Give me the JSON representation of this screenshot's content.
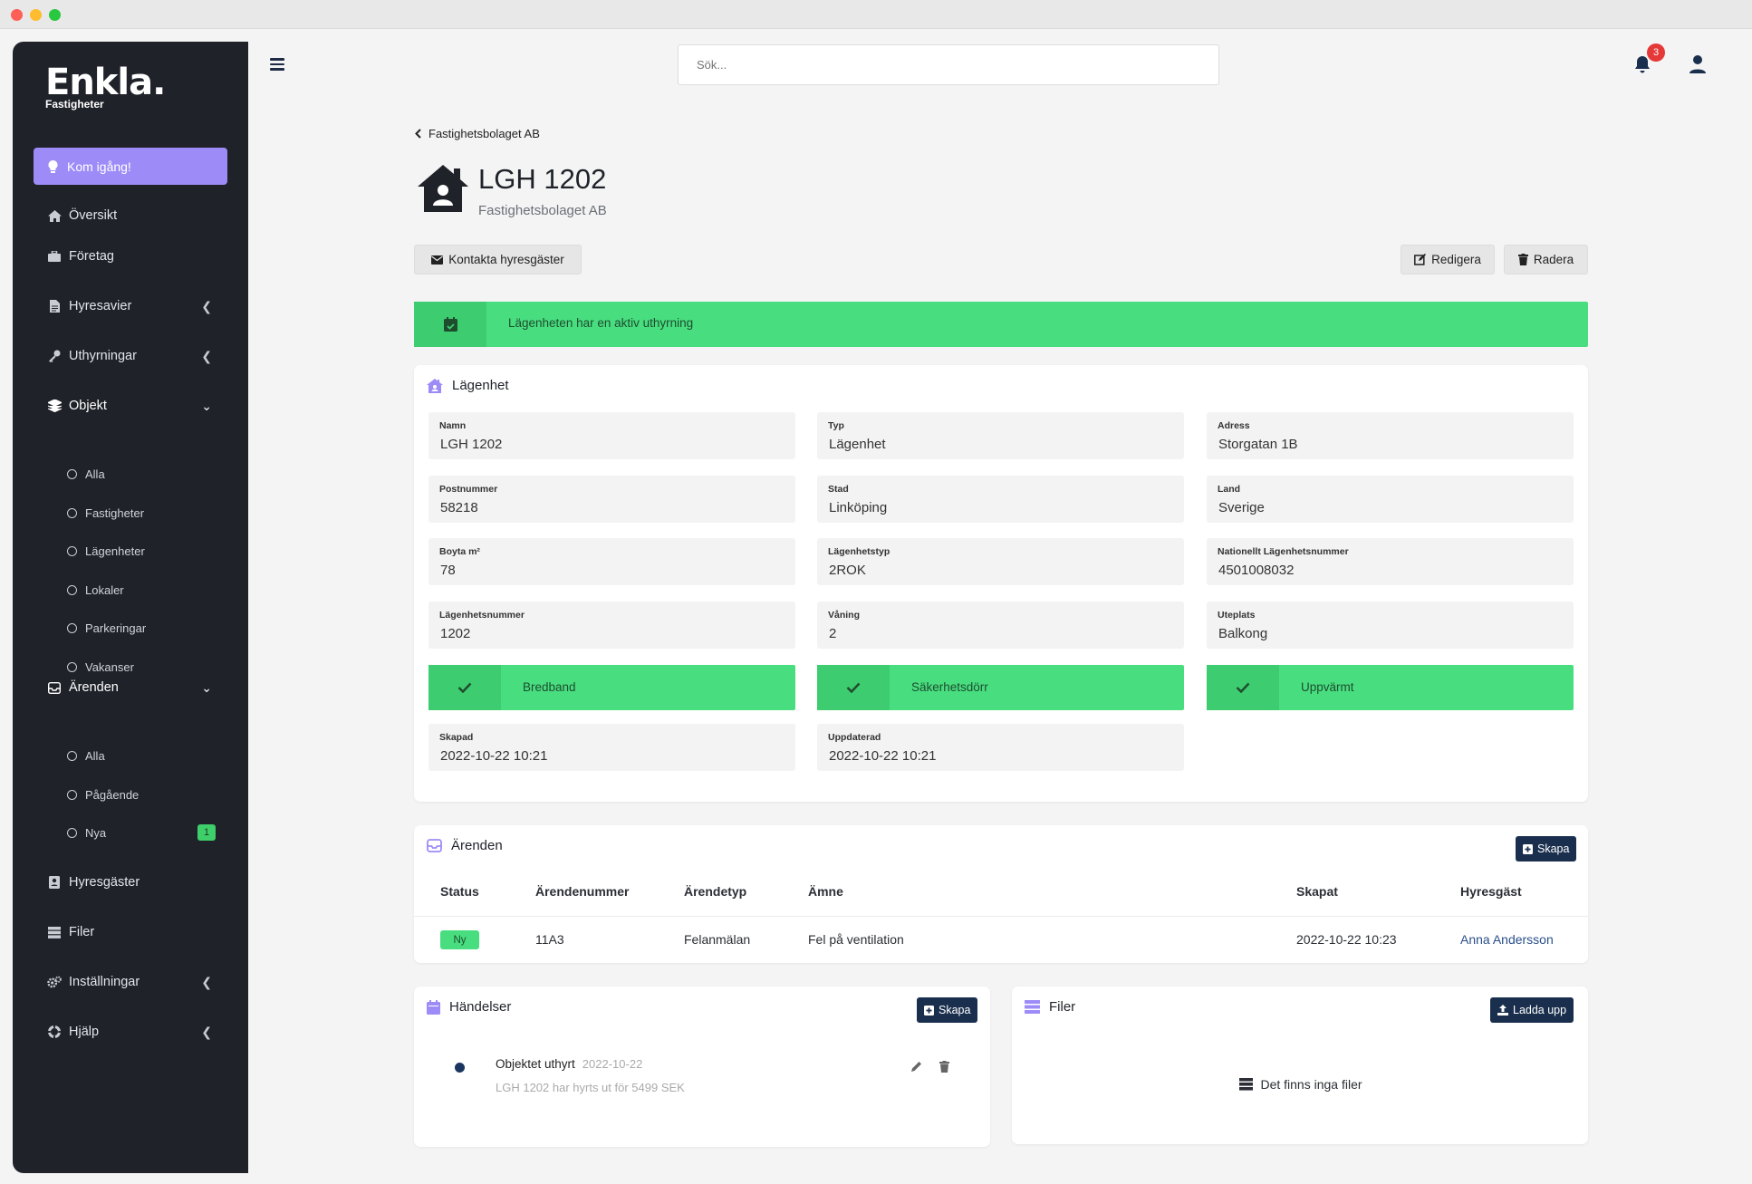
{
  "brand": {
    "name": "Enkla.",
    "sub": "Fastigheter"
  },
  "sidebar": {
    "cta": "Kom igång!",
    "items": [
      {
        "label": "Översikt",
        "icon": "home-icon"
      },
      {
        "label": "Företag",
        "icon": "briefcase-icon"
      },
      {
        "label": "Hyresavier",
        "icon": "document-icon"
      },
      {
        "label": "Uthyrningar",
        "icon": "key-icon"
      },
      {
        "label": "Objekt",
        "icon": "layers-icon"
      },
      {
        "label": "Ärenden",
        "icon": "inbox-icon"
      },
      {
        "label": "Hyresgäster",
        "icon": "contact-icon"
      },
      {
        "label": "Filer",
        "icon": "server-icon"
      },
      {
        "label": "Inställningar",
        "icon": "gears-icon"
      },
      {
        "label": "Hjälp",
        "icon": "lifering-icon"
      }
    ],
    "objekt_sub": [
      "Alla",
      "Fastigheter",
      "Lägenheter",
      "Lokaler",
      "Parkeringar",
      "Vakanser"
    ],
    "arenden_sub": [
      "Alla",
      "Pågående",
      "Nya"
    ],
    "nya_count": "1"
  },
  "topbar": {
    "search_placeholder": "Sök...",
    "notification_count": "3"
  },
  "page": {
    "breadcrumb": "Fastighetsbolaget AB",
    "title": "LGH 1202",
    "subtitle": "Fastighetsbolaget AB",
    "contact_button": "Kontakta hyresgäster",
    "edit_button": "Redigera",
    "delete_button": "Radera",
    "alert": "Lägenheten har en aktiv uthyrning"
  },
  "apartment": {
    "title": "Lägenhet",
    "fields": [
      {
        "label": "Namn",
        "value": "LGH 1202"
      },
      {
        "label": "Typ",
        "value": "Lägenhet"
      },
      {
        "label": "Adress",
        "value": "Storgatan 1B"
      },
      {
        "label": "Postnummer",
        "value": "58218"
      },
      {
        "label": "Stad",
        "value": "Linköping"
      },
      {
        "label": "Land",
        "value": "Sverige"
      },
      {
        "label": "Boyta m²",
        "value": "78"
      },
      {
        "label": "Lägenhetstyp",
        "value": "2ROK"
      },
      {
        "label": "Nationellt Lägenhetsnummer",
        "value": "4501008032"
      },
      {
        "label": "Lägenhetsnummer",
        "value": "1202"
      },
      {
        "label": "Våning",
        "value": "2"
      },
      {
        "label": "Uteplats",
        "value": "Balkong"
      }
    ],
    "features": [
      "Bredband",
      "Säkerhetsdörr",
      "Uppvärmt"
    ],
    "created": {
      "label": "Skapad",
      "value": "2022-10-22 10:21"
    },
    "updated": {
      "label": "Uppdaterad",
      "value": "2022-10-22 10:21"
    }
  },
  "cases": {
    "title": "Ärenden",
    "create_button": "Skapa",
    "columns": [
      "Status",
      "Ärendenummer",
      "Ärendetyp",
      "Ämne",
      "Skapat",
      "Hyresgäst"
    ],
    "rows": [
      {
        "status": "Ny",
        "number": "11A3",
        "type": "Felanmälan",
        "subject": "Fel på ventilation",
        "created": "2022-10-22 10:23",
        "tenant": "Anna Andersson"
      }
    ]
  },
  "events": {
    "title": "Händelser",
    "create_button": "Skapa",
    "items": [
      {
        "title": "Objektet uthyrt",
        "date": "2022-10-22",
        "desc": "LGH 1202 har hyrts ut för 5499 SEK"
      }
    ]
  },
  "files": {
    "title": "Filer",
    "upload_button": "Ladda upp",
    "empty": "Det finns inga filer"
  },
  "colors": {
    "sidebar_bg": "#1f2229",
    "accent": "#9d8cf8",
    "success": "#48de80",
    "primary_dark": "#1a2f4e",
    "danger": "#e53939"
  }
}
